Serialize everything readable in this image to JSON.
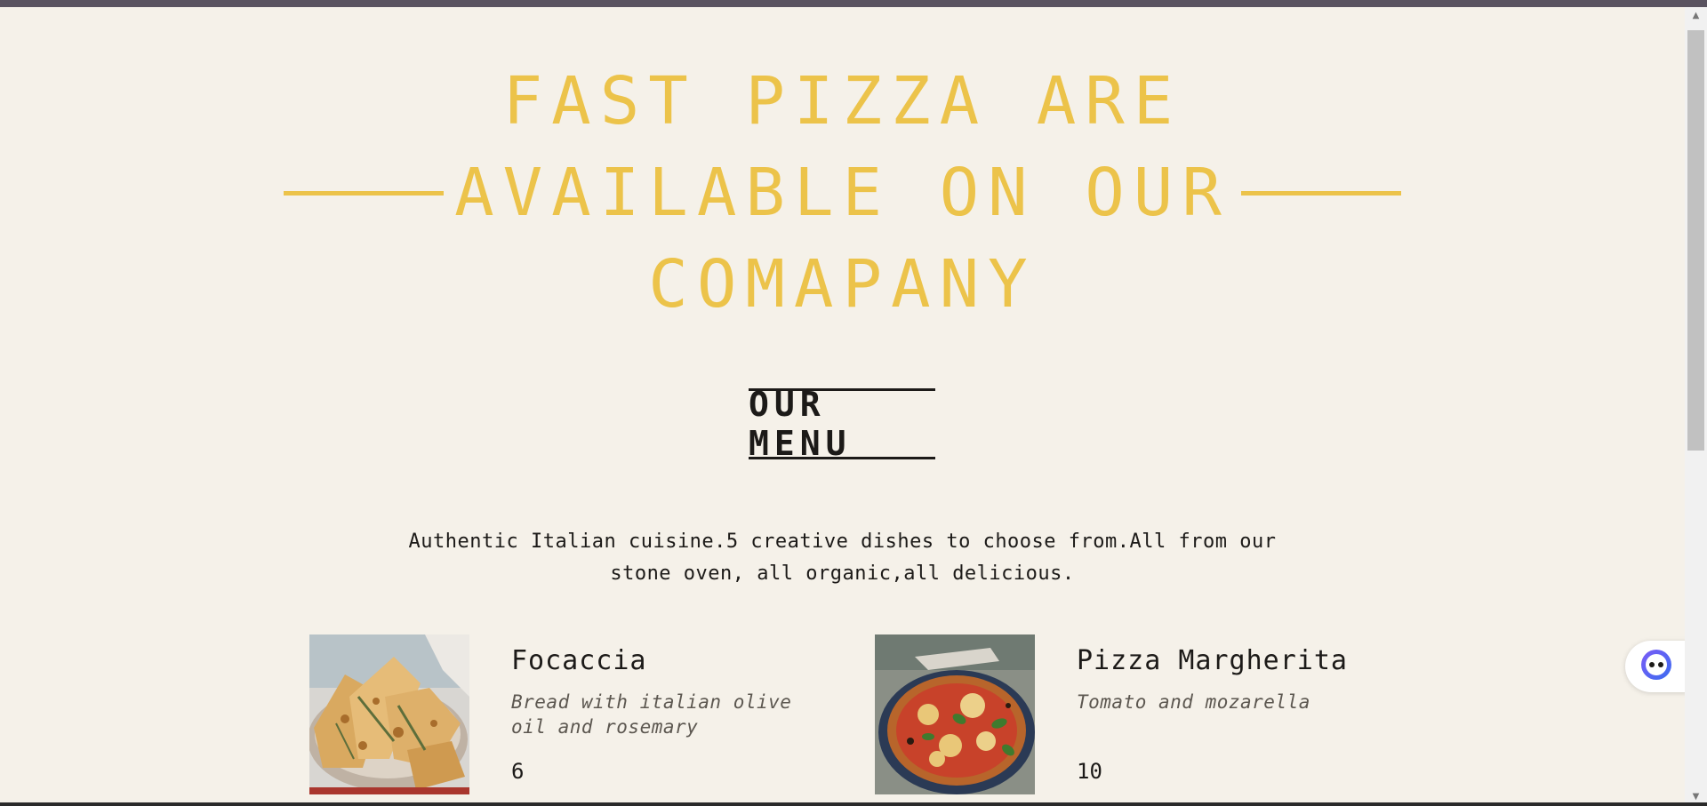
{
  "hero": {
    "line1": "FAST PIZZA ARE",
    "line2": "AVAILABLE ON OUR",
    "line3": "COMAPANY"
  },
  "menu": {
    "heading": "OUR MENU",
    "intro": "Authentic Italian cuisine.5 creative dishes to choose from.All from our stone oven, all organic,all delicious.",
    "items": [
      {
        "name": "Focaccia",
        "description": "Bread with italian olive oil and rosemary",
        "price": "6",
        "image": "focaccia-photo"
      },
      {
        "name": "Pizza Margherita",
        "description": "Tomato and mozarella",
        "price": "10",
        "image": "pizza-margherita-photo"
      }
    ]
  },
  "colors": {
    "accent": "#ecc34a",
    "text": "#1c1a18",
    "background": "#f5f1e9"
  },
  "icons": {
    "assistant": "assistant-bot-icon",
    "scroll_up": "scroll-up-arrow-icon",
    "scroll_down": "scroll-down-arrow-icon"
  }
}
